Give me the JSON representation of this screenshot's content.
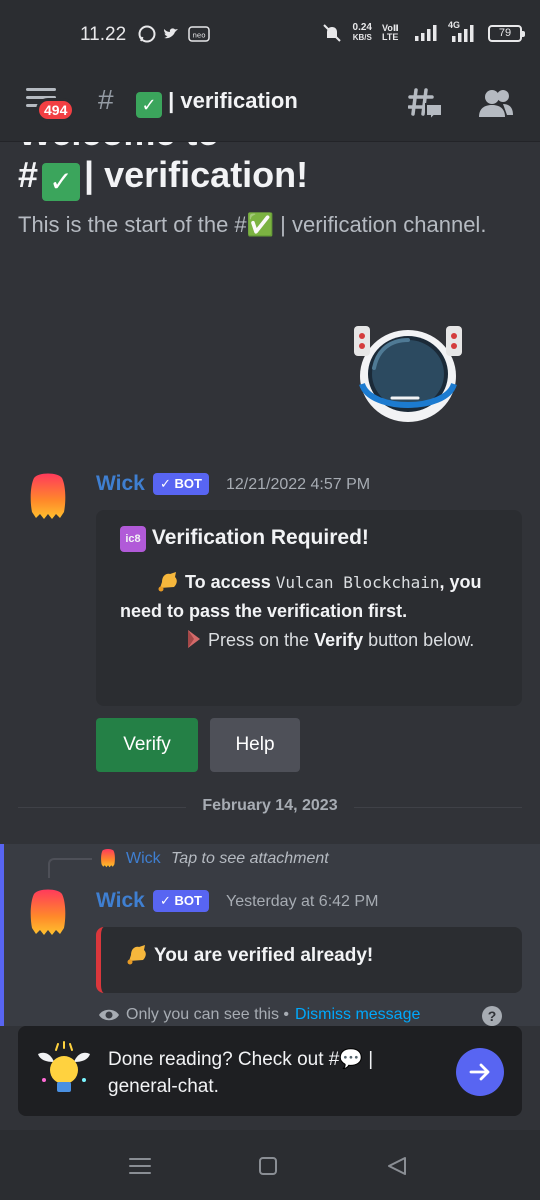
{
  "status_bar": {
    "time": "11.22",
    "speed_value": "0.24",
    "speed_unit": "KB/S",
    "volte_label": "VoⅡ LTE",
    "network_label": "4G",
    "battery": "79"
  },
  "header": {
    "badge_count": "494",
    "hash": "#",
    "channel_check": "✓",
    "channel_name": "| verification"
  },
  "welcome": {
    "cut_title": "Welcome to",
    "title_hash": "#",
    "title_check": "✓",
    "title_name": "| verification!",
    "subtitle": "This is the start of the #✅ | verification channel."
  },
  "message1": {
    "author": "Wick",
    "bot_tag": "✓ BOT",
    "timestamp": "12/21/2022 4:57 PM",
    "embed_emoji": "🔣",
    "embed_title": "Verification Required!",
    "line1_prefix": "To access",
    "line1_server": "Vulcan Blockchain",
    "line1_suffix": ", you need to pass the verification first.",
    "line2_prefix": "Press on the",
    "line2_bold": "Verify",
    "line2_suffix": "button below.",
    "verify_label": "Verify",
    "help_label": "Help"
  },
  "divider": {
    "date": "February 14, 2023"
  },
  "message2": {
    "reply_author": "Wick",
    "reply_text": "Tap to see attachment",
    "author": "Wick",
    "bot_tag": "✓ BOT",
    "timestamp": "Yesterday at 6:42 PM",
    "embed_text": "You are verified already!",
    "ephemeral_note": "Only you can see this •",
    "dismiss_label": "Dismiss message",
    "help_label": "?"
  },
  "nudge": {
    "text": "Done reading? Check out #💬 | general-chat."
  },
  "colors": {
    "background": "#313338",
    "blurple": "#5865f2",
    "green_button": "#248046",
    "link": "#00a8fc",
    "badge_red": "#f23f43"
  }
}
